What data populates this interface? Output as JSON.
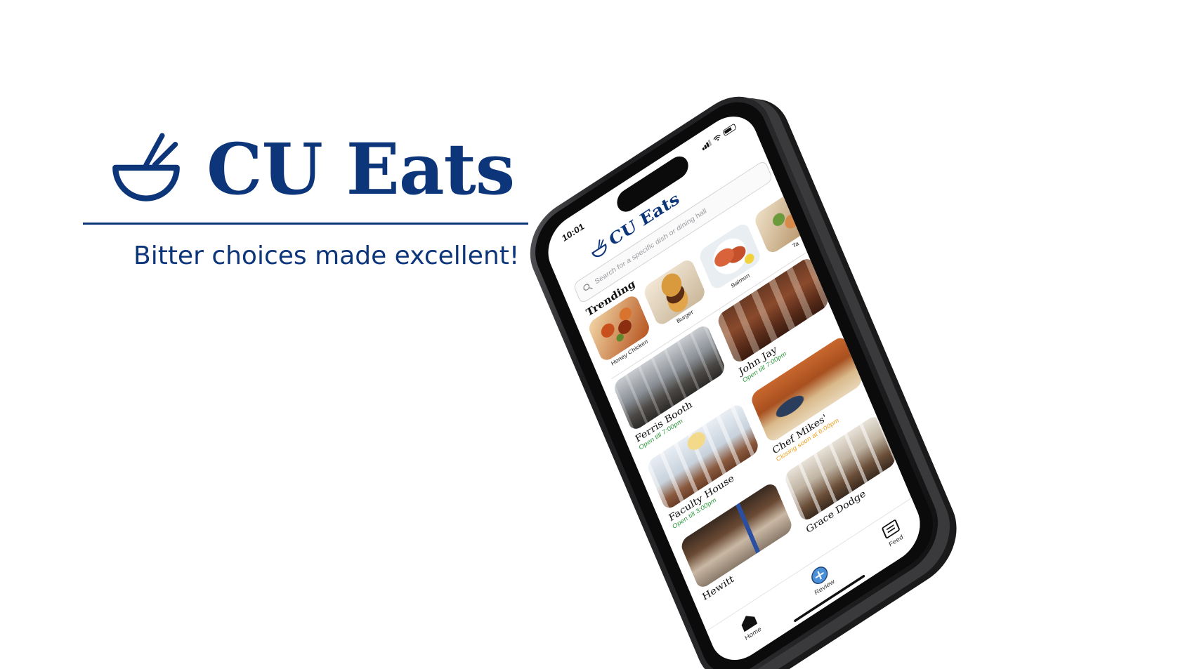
{
  "brand": {
    "title": "CU Eats",
    "tagline": "Bitter choices made excellent!",
    "logo_icon": "bowl-chopsticks-icon",
    "color": "#0d357a"
  },
  "app": {
    "status": {
      "time": "10:01"
    },
    "logo_text": "CU Eats",
    "search": {
      "placeholder": "Search for a specific dish or dining hall",
      "value": ""
    },
    "trending": {
      "title": "Trending",
      "items": [
        {
          "label": "Honey Chicken",
          "icon": "food-photo"
        },
        {
          "label": "Burger",
          "icon": "food-photo"
        },
        {
          "label": "Salmon",
          "icon": "food-photo"
        },
        {
          "label": "Ta",
          "icon": "food-photo"
        }
      ]
    },
    "dining_halls": [
      {
        "name": "Ferris Booth",
        "status": "Open till 7:00pm",
        "status_color": "#2e9a3e"
      },
      {
        "name": "John Jay",
        "status": "Open till 7:00pm",
        "status_color": "#2e9a3e"
      },
      {
        "name": "Faculty House",
        "status": "Open till 3:00pm",
        "status_color": "#2e9a3e"
      },
      {
        "name": "Chef Mikes'",
        "status": "Closing soon at 6:00pm",
        "status_color": "#f0a020"
      },
      {
        "name": "Hewitt",
        "status": "",
        "status_color": "#2e9a3e"
      },
      {
        "name": "Grace Dodge",
        "status": "",
        "status_color": "#2e9a3e"
      }
    ],
    "tabs": [
      {
        "label": "Home",
        "icon": "home-icon"
      },
      {
        "label": "Review",
        "icon": "plus-circle-icon"
      },
      {
        "label": "Feed",
        "icon": "feed-icon"
      }
    ],
    "accent": "#4a90d9"
  }
}
